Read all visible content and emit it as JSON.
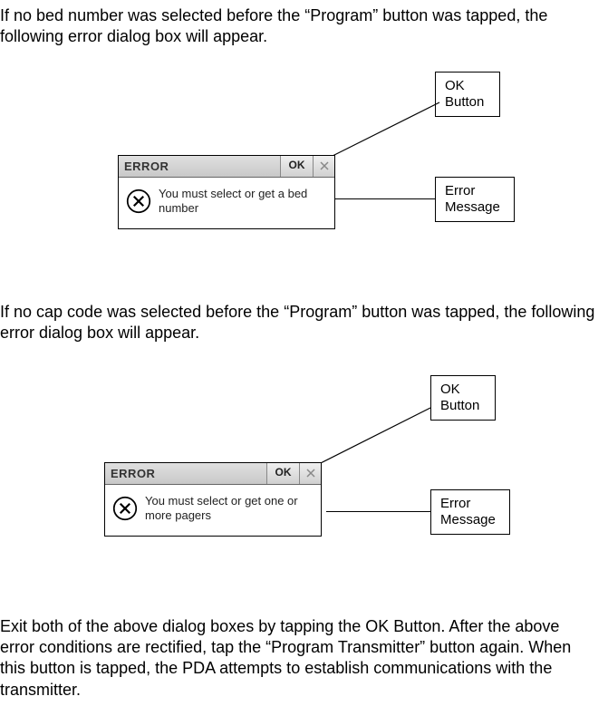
{
  "para1": "If no bed number was selected before the “Program” button was tapped, the following error dialog box will appear.",
  "para2": "If no cap code was selected before the “Program” button was tapped, the following error dialog box will appear.",
  "para3": "Exit both of the above dialog boxes by tapping the OK Button.  After the above error conditions are rectified, tap the “Program Transmitter” button again.  When this button is tapped, the PDA attempts to establish communications with the transmitter.",
  "dialog1": {
    "title": "ERROR",
    "ok": "OK",
    "message": "You must select or get a bed number"
  },
  "dialog2": {
    "title": "ERROR",
    "ok": "OK",
    "message": "You must select or get one or more pagers"
  },
  "callouts": {
    "okButton": "OK\nButton",
    "errorMessage": "Error\nMessage"
  }
}
